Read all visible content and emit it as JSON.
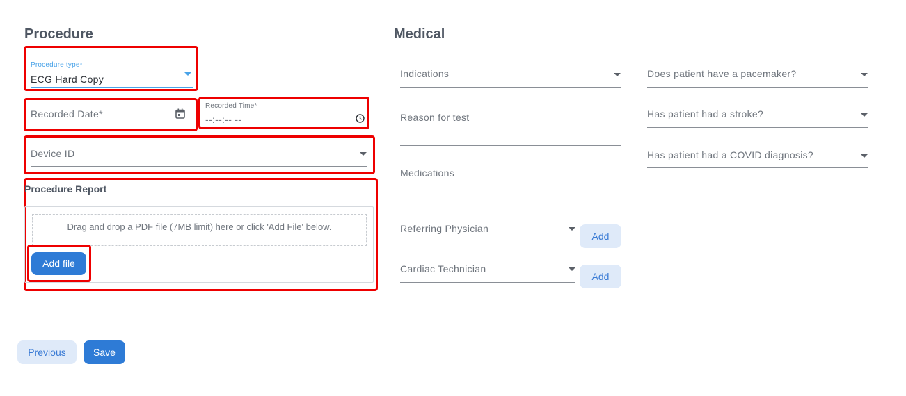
{
  "procedure": {
    "title": "Procedure",
    "procedure_type": {
      "label": "Procedure type*",
      "value": "ECG Hard Copy"
    },
    "recorded_date": {
      "placeholder": "Recorded Date*"
    },
    "recorded_time": {
      "label": "Recorded Time*",
      "value": "--:--:-- --"
    },
    "device_id": {
      "placeholder": "Device ID"
    },
    "report": {
      "title": "Procedure Report",
      "dropzone_text": "Drag and drop a PDF file (7MB limit) here or click 'Add File' below.",
      "add_file_label": "Add file"
    }
  },
  "medical": {
    "title": "Medical",
    "indications": {
      "placeholder": "Indications"
    },
    "reason_for_test": {
      "placeholder": "Reason for test"
    },
    "medications": {
      "placeholder": "Medications"
    },
    "referring_physician": {
      "placeholder": "Referring Physician",
      "add_label": "Add"
    },
    "cardiac_technician": {
      "placeholder": "Cardiac Technician",
      "add_label": "Add"
    },
    "pacemaker": {
      "placeholder": "Does patient have a pacemaker?"
    },
    "stroke": {
      "placeholder": "Has patient had a stroke?"
    },
    "covid": {
      "placeholder": "Has patient had a COVID diagnosis?"
    }
  },
  "footer": {
    "previous_label": "Previous",
    "save_label": "Save"
  },
  "colors": {
    "highlight": "#ee0000",
    "primary": "#2e7bd6",
    "primary_light": "#dfeaf9",
    "label_blue": "#4aa3e8"
  }
}
